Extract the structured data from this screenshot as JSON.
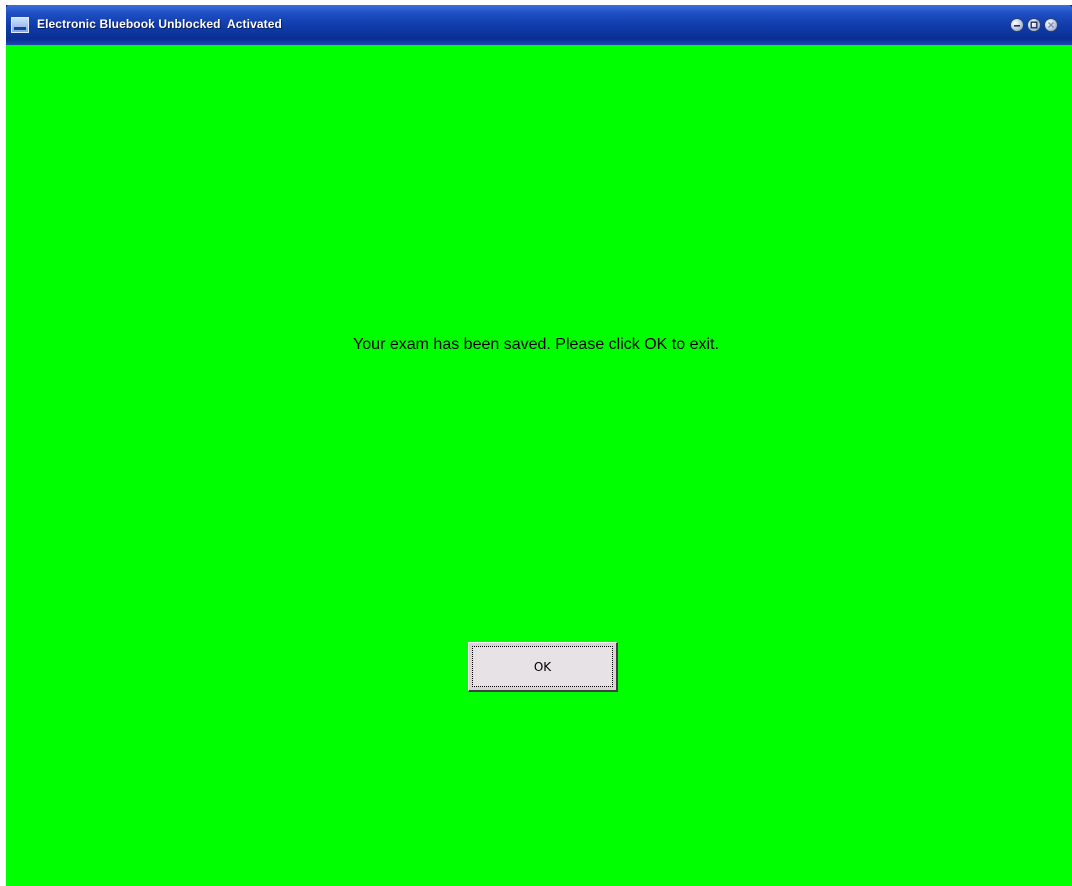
{
  "window": {
    "title": "Electronic Bluebook Unblocked  Activated"
  },
  "dialog": {
    "message": "Your exam has been saved.  Please click OK to exit.",
    "ok_label": "OK"
  },
  "colors": {
    "background": "#00ff00",
    "titlebar": "#0f3aa8",
    "button_face": "#d9d5d7"
  },
  "icons": {
    "app": "bluebook-app-icon",
    "minimize": "minimize-icon",
    "maximize": "maximize-icon",
    "close": "close-icon"
  }
}
